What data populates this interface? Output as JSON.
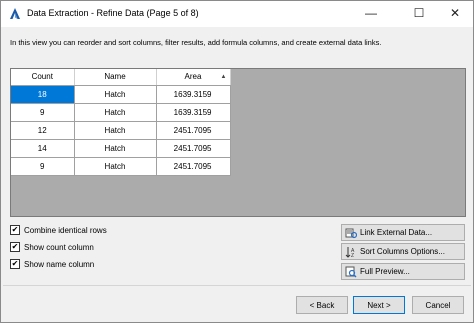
{
  "window": {
    "title": "Data Extraction - Refine Data (Page 5 of 8)",
    "minimize_glyph": "—",
    "maximize_glyph": "☐",
    "close_glyph": "✕",
    "app_icon": "autocad-a-icon"
  },
  "description": "In this view you can reorder and sort columns, filter results, add formula columns, and create external data links.",
  "grid": {
    "columns": [
      {
        "label": "Count"
      },
      {
        "label": "Name"
      },
      {
        "label": "Area",
        "sort_indicator": "▲"
      }
    ],
    "rows": [
      {
        "count": "18",
        "name": "Hatch",
        "area": "1639.3159",
        "selected": true
      },
      {
        "count": "9",
        "name": "Hatch",
        "area": "1639.3159"
      },
      {
        "count": "12",
        "name": "Hatch",
        "area": "2451.7095"
      },
      {
        "count": "14",
        "name": "Hatch",
        "area": "2451.7095"
      },
      {
        "count": "9",
        "name": "Hatch",
        "area": "2451.7095"
      }
    ]
  },
  "options": {
    "combine_identical_rows": {
      "label": "Combine identical rows",
      "checked": true
    },
    "show_count_column": {
      "label": "Show count column",
      "checked": true
    },
    "show_name_column": {
      "label": "Show name column",
      "checked": true
    },
    "check_glyph": "✔"
  },
  "actions": {
    "link_external_data": {
      "label": "Link External Data...",
      "icon": "link-data-icon"
    },
    "sort_columns_options": {
      "label": "Sort Columns Options...",
      "icon": "sort-icon"
    },
    "full_preview": {
      "label": "Full Preview...",
      "icon": "preview-icon"
    }
  },
  "navigation": {
    "back": "< Back",
    "next": "Next >",
    "cancel": "Cancel"
  },
  "colors": {
    "selection": "#0078d7",
    "grid_background": "#ababab",
    "dialog_background": "#f0f0f0"
  }
}
